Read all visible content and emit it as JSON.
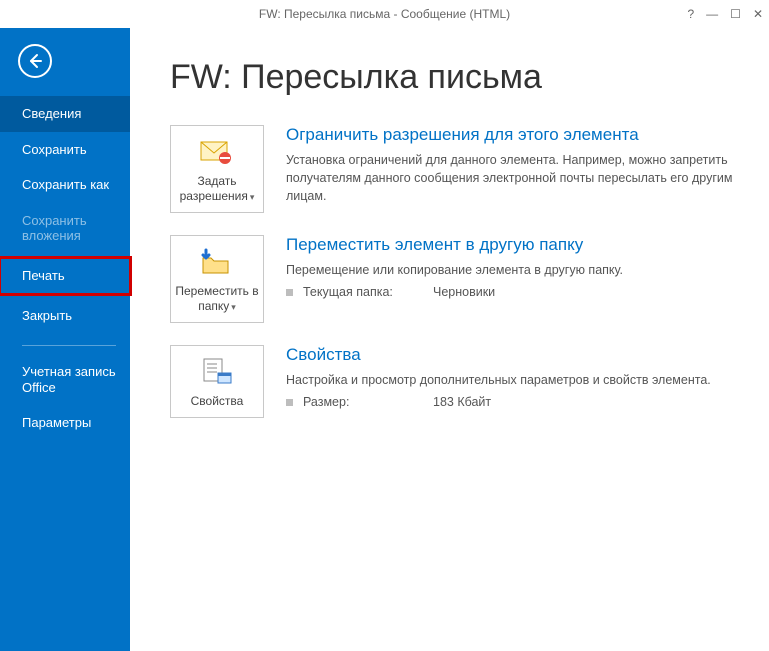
{
  "titlebar": {
    "title": "FW: Пересылка письма - Сообщение (HTML)"
  },
  "sidebar": {
    "items": [
      {
        "label": "Сведения",
        "state": "selected"
      },
      {
        "label": "Сохранить",
        "state": ""
      },
      {
        "label": "Сохранить как",
        "state": ""
      },
      {
        "label": "Сохранить вложения",
        "state": "disabled"
      },
      {
        "label": "Печать",
        "state": "highlighted"
      },
      {
        "label": "Закрыть",
        "state": ""
      }
    ],
    "account_label": "Учетная запись Office",
    "options_label": "Параметры"
  },
  "page": {
    "heading": "FW: Пересылка письма"
  },
  "sections": [
    {
      "tile_label": "Задать разрешения",
      "tile_has_caret": true,
      "title": "Ограничить разрешения для этого элемента",
      "desc": "Установка ограничений для данного элемента. Например, можно запретить получателям данного сообщения электронной почты пересылать его другим лицам."
    },
    {
      "tile_label": "Переместить в папку",
      "tile_has_caret": true,
      "title": "Переместить элемент в другую папку",
      "desc": "Перемещение или копирование элемента в другую папку.",
      "kv": {
        "label": "Текущая папка:",
        "value": "Черновики"
      }
    },
    {
      "tile_label": "Свойства",
      "tile_has_caret": false,
      "title": "Свойства",
      "desc": "Настройка и просмотр дополнительных параметров и свойств элемента.",
      "kv": {
        "label": "Размер:",
        "value": "183 Кбайт"
      }
    }
  ]
}
